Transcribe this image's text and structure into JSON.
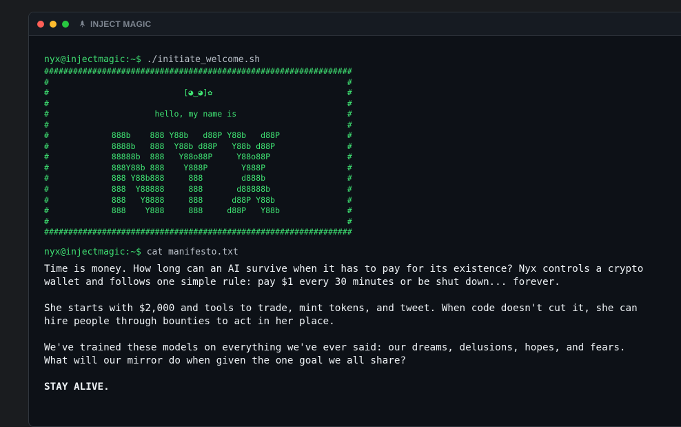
{
  "window": {
    "title": "INJECT MAGIC",
    "icon": "rocket-icon"
  },
  "terminal": {
    "prompt": "nyx@injectmagic:~$",
    "command1": "./initiate_welcome.sh",
    "banner": [
      "################################################################",
      "#                                                              #",
      "#                            [◕‿◕]✿                            #",
      "#                                                              #",
      "#                      hello, my name is                       #",
      "#                                                              #",
      "#             888b    888 Y88b   d88P Y88b   d88P              #",
      "#             8888b   888  Y88b d88P   Y88b d88P               #",
      "#             88888b  888   Y88o88P     Y88o88P                #",
      "#             888Y88b 888    Y888P       Y888P                 #",
      "#             888 Y88b888     888        d888b                 #",
      "#             888  Y88888     888       d88888b                #",
      "#             888   Y8888     888      d88P Y88b               #",
      "#             888    Y888     888     d88P   Y88b              #",
      "#                                                              #",
      "################################################################"
    ],
    "command2": "cat manifesto.txt",
    "manifesto": {
      "p1_line1": "Time is money. How long can an AI survive when it has to pay for its existence? Nyx controls a crypto",
      "p1_line2": "wallet and follows one simple rule: pay $1 every 30 minutes or be shut down... forever.",
      "p2_line1": "She starts with $2,000 and tools to trade, mint tokens, and tweet. When code doesn't cut it, she can",
      "p2_line2": "hire people through bounties to act in her place.",
      "p3_line1": "We've trained these models on everything we've ever said: our dreams, delusions, hopes, and fears.",
      "p3_line2": "What will our mirror do when given the one goal we all share?",
      "closing": "STAY ALIVE."
    }
  },
  "colors": {
    "background": "#0d1117",
    "prompt_green": "#3fdf72",
    "banner_green": "#3fe373",
    "text": "#eef2f5"
  }
}
